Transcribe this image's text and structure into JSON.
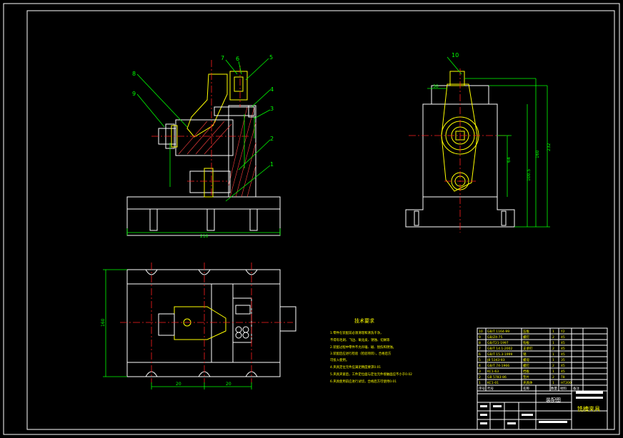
{
  "balloons_front": [
    "7",
    "6",
    "5",
    "4",
    "3",
    "2",
    "1",
    "8",
    "9"
  ],
  "balloon_side": "10",
  "dimensions": {
    "front_width": "210",
    "top_left_w": "20",
    "top_right_w": "20",
    "top_height": "160",
    "side_d1": "120",
    "side_d2": "100.5",
    "side_d3": "160",
    "side_d4": "232",
    "side_d5": "64",
    "side_top": "30"
  },
  "tech_title": "技术要求",
  "tech_lines": [
    "1.零件在装配前必须清理和清洗干净，",
    "  不得有毛刺、飞边、氧化皮、锈蚀、切屑等",
    "2.装配过程中零件不允许磕、碰、划伤和锈蚀。",
    "3.装配后应进行检验（检验项目），合格后方",
    "  可投入使用。",
    "4.夹具定位元件应满足精度要求0.01",
    "5.夹具夹紧后，工件定位面与定位元件接触面应不小于0.02",
    "6.夹具使用前应进行试切，合格后方可使用0.01"
  ],
  "bom_rows": [
    {
      "no": "10",
      "code": "GB/T 1164-99",
      "name": "压板",
      "qty": "1",
      "mat": "Y2"
    },
    {
      "no": "9",
      "code": "GB/Z4-75",
      "name": "螺钉",
      "qty": "2",
      "mat": "45"
    },
    {
      "no": "8",
      "code": "GB/T21-1997",
      "name": "钩板",
      "qty": "1",
      "mat": "45"
    },
    {
      "no": "7",
      "code": "GB/T 14.1-2002",
      "name": "支承钉",
      "qty": "2",
      "mat": "45"
    },
    {
      "no": "6",
      "code": "GB/T 15.3-1999",
      "name": "销",
      "qty": "1",
      "mat": "45"
    },
    {
      "no": "5",
      "code": "JB 5343-83",
      "name": "螺母",
      "qty": "1",
      "mat": "35"
    },
    {
      "no": "4",
      "code": "GB/T 74-1966",
      "name": "螺钉",
      "qty": "2",
      "mat": "45"
    },
    {
      "no": "3",
      "code": "KC1-63",
      "name": "挡板",
      "qty": "1",
      "mat": "45"
    },
    {
      "no": "2",
      "code": "GB 5783-86",
      "name": "垫片",
      "qty": "2",
      "mat": "T8"
    },
    {
      "no": "1",
      "code": "KC1-01",
      "name": "夹具体",
      "qty": "1",
      "mat": "HT200"
    }
  ],
  "bom_header": {
    "no": "序号",
    "code": "代号",
    "name": "名称",
    "qty": "数量",
    "mat": "材料",
    "note": "备注"
  },
  "title_block": {
    "drawing_name": "装配图",
    "part_name": "铣槽夹具",
    "scale_label": "比例",
    "sheet_label": "共 张"
  },
  "colors": {
    "frame": "#ffffff",
    "part": "#ffff00",
    "center": "#ff2020",
    "dim": "#00ff00"
  }
}
